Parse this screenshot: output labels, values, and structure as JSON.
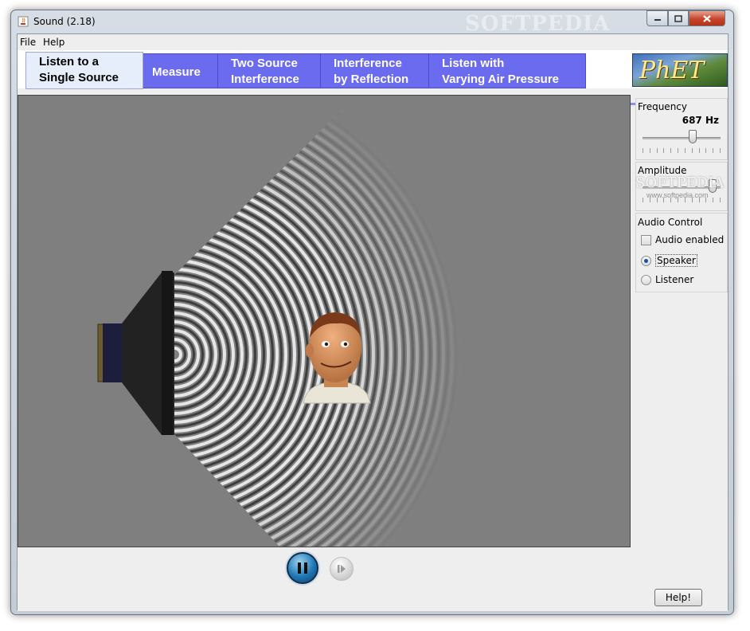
{
  "window": {
    "title": "Sound (2.18)",
    "watermark": "SOFTPEDIA"
  },
  "menu": {
    "items": [
      "File",
      "Help"
    ]
  },
  "tabs": [
    {
      "label": "Listen to a\nSingle Source",
      "selected": true
    },
    {
      "label": "Measure",
      "selected": false
    },
    {
      "label": "Two Source\nInterference",
      "selected": false
    },
    {
      "label": "Interference\nby Reflection",
      "selected": false
    },
    {
      "label": "Listen with\nVarying Air Pressure",
      "selected": false
    }
  ],
  "logo": {
    "text": "PhET"
  },
  "controls": {
    "frequency": {
      "title": "Frequency",
      "value": "687 Hz",
      "level": 0.64
    },
    "amplitude": {
      "title": "Amplitude",
      "level": 0.9
    },
    "watermark": "SOFTPEDIA",
    "watermark_url": "www.softpedia.com",
    "audio": {
      "title": "Audio Control",
      "enabled_label": "Audio enabled",
      "enabled": false,
      "options": [
        {
          "label": "Speaker",
          "selected": true
        },
        {
          "label": "Listener",
          "selected": false
        }
      ]
    }
  },
  "playback": {
    "pause_icon": "pause-icon",
    "step_icon": "step-icon"
  },
  "help_button": "Help!",
  "colors": {
    "tab_blue": "#6b6bf0",
    "selected_tab": "#e6eefb",
    "sim_background": "#7f7f7f"
  }
}
